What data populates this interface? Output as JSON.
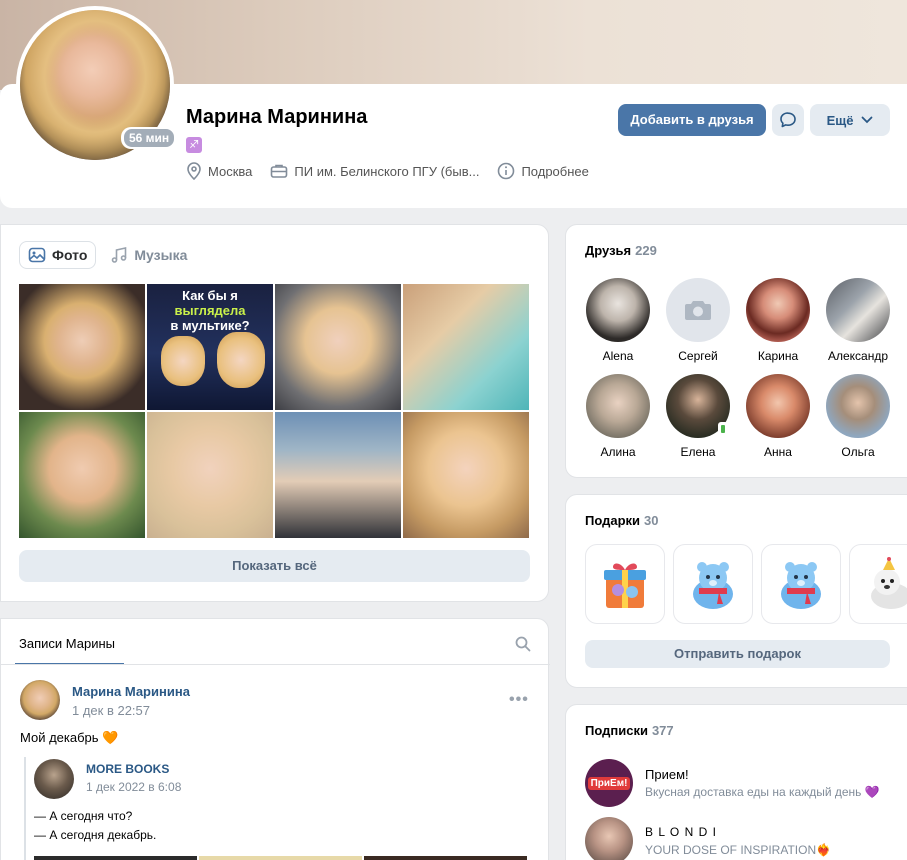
{
  "profile": {
    "name": "Марина Маринина",
    "online": "56 мин",
    "zodiac": "♐",
    "city": "Москва",
    "education": "ПИ им. Белинского ПГУ (быв...",
    "more_info": "Подробнее",
    "add_friend": "Добавить в друзья",
    "more": "Ещё"
  },
  "photos": {
    "tabs": [
      "Фото",
      "Музыка"
    ],
    "show_all": "Показать всё",
    "cartoon_caption": [
      "Как бы я",
      "выглядела",
      "в мультике?"
    ]
  },
  "wall": {
    "tab": "Записи Марины",
    "post": {
      "author": "Марина Маринина",
      "date": "1 дек в 22:57",
      "text": "Мой декабрь 🧡",
      "repost": {
        "author": "MORE BOOKS",
        "date": "1 дек 2022 в 6:08",
        "line1": "— А сегодня что?",
        "line2": "— А сегодня декабрь."
      }
    }
  },
  "friends": {
    "title": "Друзья",
    "count": "229",
    "items": [
      {
        "name": "Alena",
        "color": "#cfc6bd"
      },
      {
        "name": "Сергей",
        "color": "#e1e5eb",
        "icon": "camera-icon"
      },
      {
        "name": "Карина",
        "color": "#c55d4f"
      },
      {
        "name": "Александр",
        "color": "#7a7c80"
      },
      {
        "name": "Алина",
        "color": "#a89d90"
      },
      {
        "name": "Елена",
        "color": "#3e4a3b",
        "mobile": true
      },
      {
        "name": "Анна",
        "color": "#b56b54"
      },
      {
        "name": "Ольга",
        "color": "#8fa2b6"
      }
    ]
  },
  "gifts": {
    "title": "Подарки",
    "count": "30",
    "send": "Отправить подарок",
    "items": [
      "box-gift-icon",
      "bear-scarf-gift-icon",
      "bear-scarf-gift-icon",
      "dog-party-gift-icon"
    ]
  },
  "subscriptions": {
    "title": "Подписки",
    "count": "377",
    "items": [
      {
        "name": "Прием!",
        "desc": "Вкусная доставка еды на каждый день 💜",
        "logo_text": "ПриЕм!"
      },
      {
        "name": "B L O N D I",
        "desc": "YOUR DOSE OF INSPIRATION❤️‍🔥"
      }
    ]
  },
  "colors": {
    "accent": "#4a76a8",
    "link": "#2a5885",
    "secondary": "#818c99",
    "button_secondary_bg": "#e5ebf1"
  }
}
